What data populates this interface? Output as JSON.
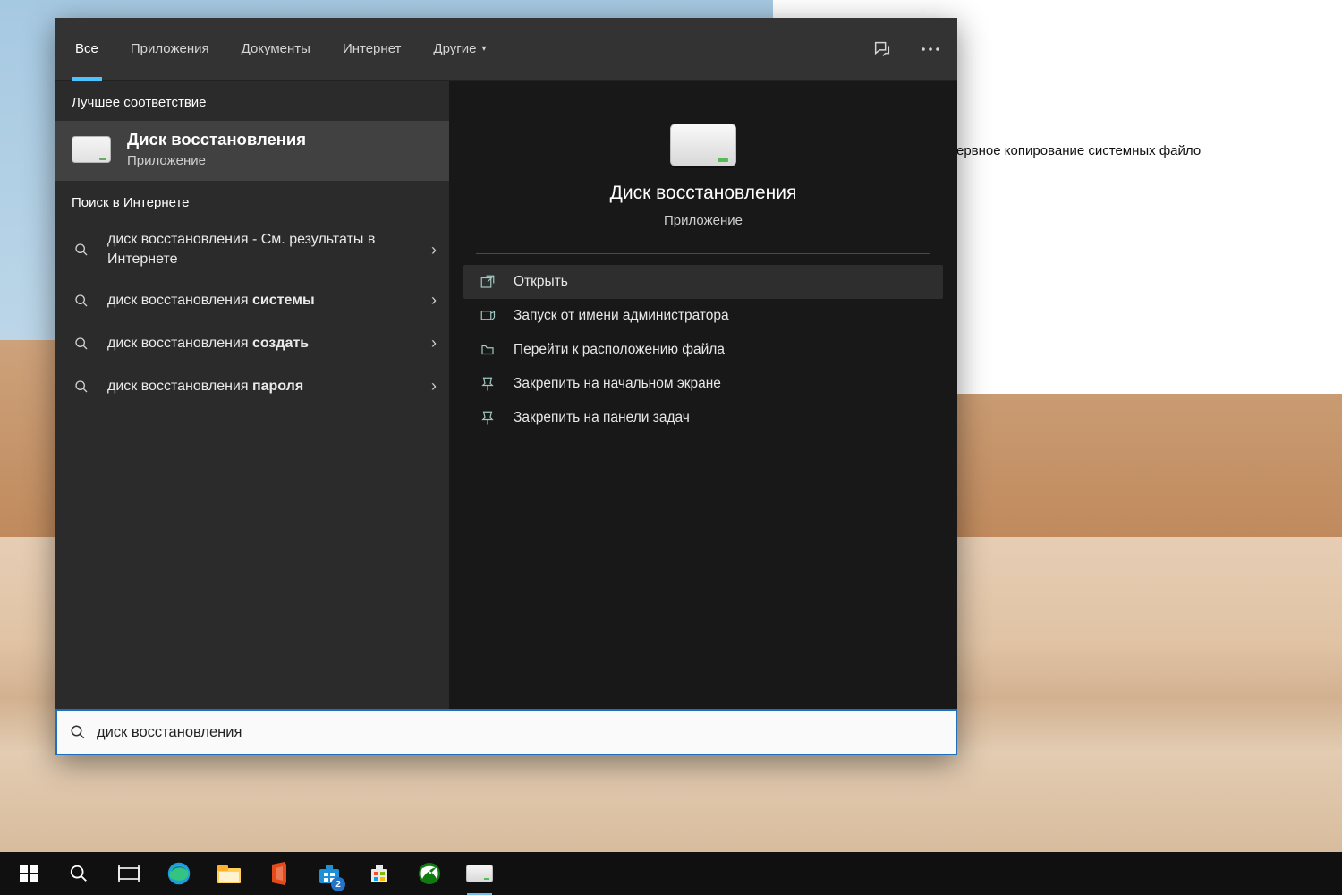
{
  "tabs": {
    "all": "Все",
    "apps": "Приложения",
    "docs": "Документы",
    "internet": "Интернет",
    "more": "Другие"
  },
  "left": {
    "best_header": "Лучшее соответствие",
    "best_title": "Диск восстановления",
    "best_sub": "Приложение",
    "web_header": "Поиск в Интернете",
    "web_items": [
      {
        "plain": "диск восстановления",
        "bold": "",
        "suffix": " - См. результаты в Интернете"
      },
      {
        "plain": "диск восстановления ",
        "bold": "системы",
        "suffix": ""
      },
      {
        "plain": "диск восстановления ",
        "bold": "создать",
        "suffix": ""
      },
      {
        "plain": "диск восстановления ",
        "bold": "пароля",
        "suffix": ""
      }
    ]
  },
  "right": {
    "title": "Диск восстановления",
    "sub": "Приложение",
    "actions": [
      "Открыть",
      "Запуск от имени администратора",
      "Перейти к расположению файла",
      "Закрепить на начальном экране",
      "Закрепить на панели задач"
    ]
  },
  "search": {
    "value": "диск восстановления"
  },
  "bg_window": {
    "text": "ервное копирование системных файло"
  },
  "taskbar": {
    "store_badge": "2"
  }
}
